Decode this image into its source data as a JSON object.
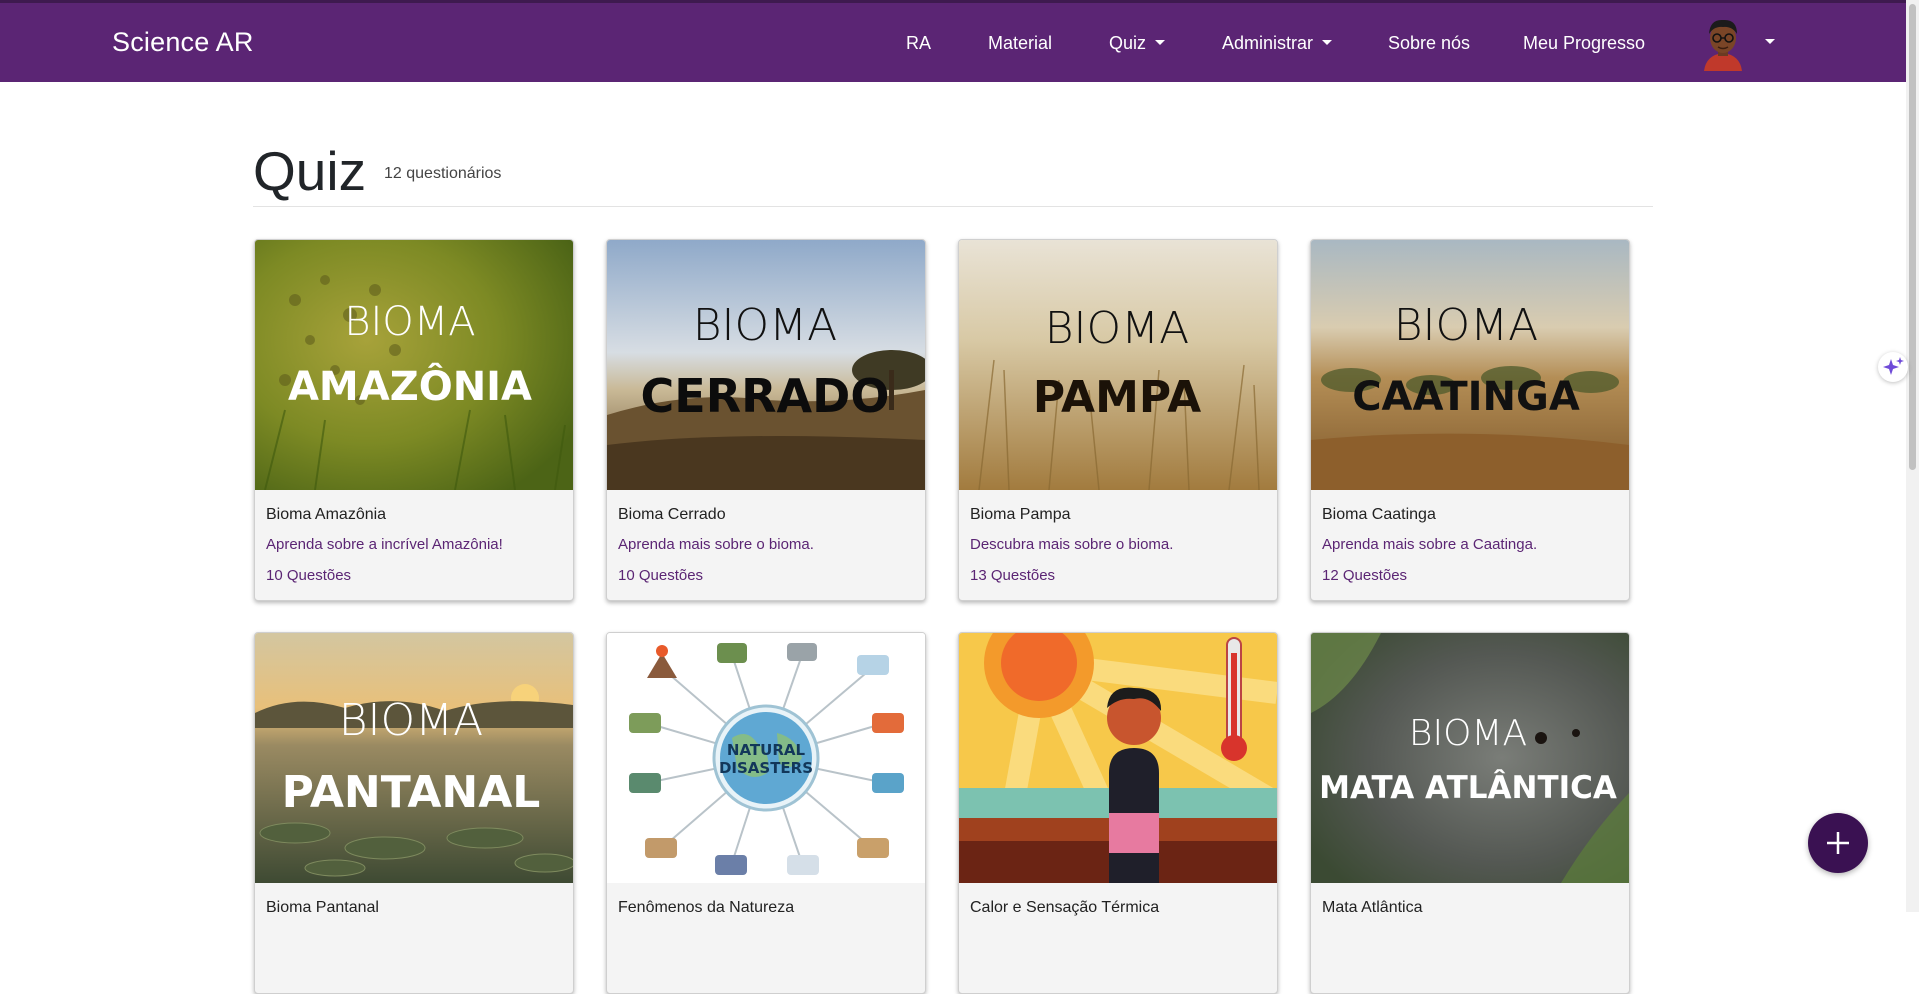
{
  "navbar": {
    "brand": "Science AR",
    "items": [
      {
        "label": "RA"
      },
      {
        "label": "Material"
      },
      {
        "label": "Quiz"
      },
      {
        "label": "Administrar"
      },
      {
        "label": "Sobre nós"
      },
      {
        "label": "Meu Progresso"
      }
    ]
  },
  "header": {
    "title": "Quiz",
    "count": "12 questionários"
  },
  "cards": [
    {
      "image_word": "BIOMA",
      "image_name": "AMAZÔNIA",
      "title": "Bioma Amazônia",
      "desc": "Aprenda sobre a incrível Amazônia!",
      "questions": "10 Questões"
    },
    {
      "image_word": "BIOMA",
      "image_name": "CERRADO",
      "title": "Bioma Cerrado",
      "desc": "Aprenda mais sobre o bioma.",
      "questions": "10 Questões"
    },
    {
      "image_word": "BIOMA",
      "image_name": "PAMPA",
      "title": "Bioma Pampa",
      "desc": "Descubra mais sobre o bioma.",
      "questions": "13 Questões"
    },
    {
      "image_word": "BIOMA",
      "image_name": "CAATINGA",
      "title": "Bioma Caatinga",
      "desc": "Aprenda mais sobre a Caatinga.",
      "questions": "12 Questões"
    },
    {
      "image_word": "BIOMA",
      "image_name": "PANTANAL",
      "title": "Bioma Pantanal"
    },
    {
      "image_line1": "NATURAL",
      "image_line2": "DISASTERS",
      "title": "Fenômenos da Natureza"
    },
    {
      "title": "Calor e Sensação Térmica"
    },
    {
      "image_word": "BIOMA",
      "image_name": "MATA ATLÂNTICA",
      "title": "Mata Atlântica"
    }
  ],
  "colors": {
    "navbar": "#5b2574",
    "accent_text": "#5b2574",
    "fab": "#3a1152"
  },
  "icons": {
    "fab": "plus-icon",
    "side": "sparkle-icon",
    "avatar": "user-avatar"
  }
}
